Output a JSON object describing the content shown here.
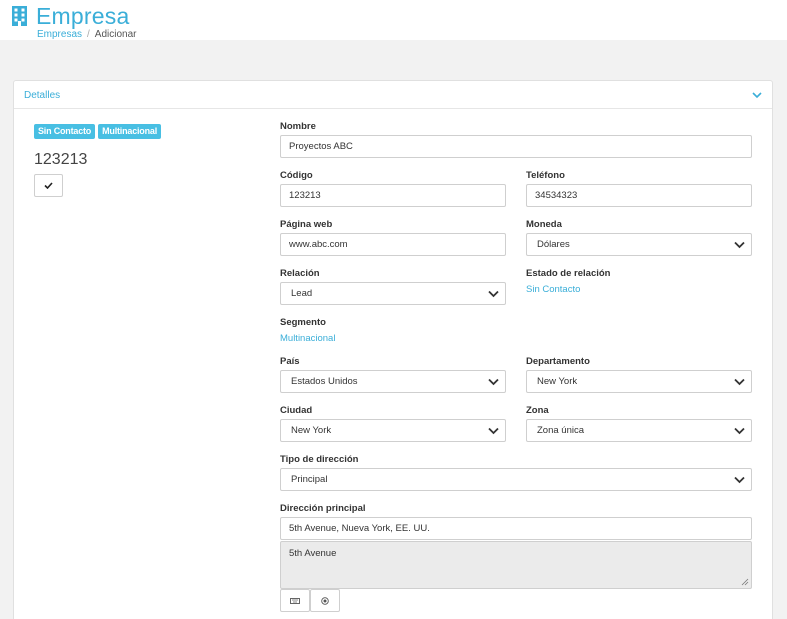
{
  "header": {
    "icon": "building-icon",
    "title": "Empresa",
    "breadcrumb": [
      "Empresas",
      "Adicionar"
    ],
    "accent_color": "#3aaed8"
  },
  "panel": {
    "title": "Detalles",
    "chevron_icon": "chevron-down-icon"
  },
  "summary": {
    "badges": [
      "Sin Contacto",
      "Multinacional"
    ],
    "badge_color": "#48bfe3",
    "code": "123213",
    "check_icon": "check-icon"
  },
  "form": {
    "nombre": {
      "label": "Nombre",
      "value": "Proyectos ABC"
    },
    "codigo": {
      "label": "Código",
      "value": "123213"
    },
    "telefono": {
      "label": "Teléfono",
      "value": "34534323"
    },
    "pagina_web": {
      "label": "Página web",
      "value": "www.abc.com"
    },
    "moneda": {
      "label": "Moneda",
      "value": "Dólares"
    },
    "relacion": {
      "label": "Relación",
      "value": "Lead"
    },
    "estado_relacion": {
      "label": "Estado de relación",
      "value": "Sin Contacto"
    },
    "segmento": {
      "label": "Segmento",
      "value": "Multinacional"
    },
    "pais": {
      "label": "País",
      "value": "Estados Unidos"
    },
    "departamento": {
      "label": "Departamento",
      "value": "New York"
    },
    "ciudad": {
      "label": "Ciudad",
      "value": "New York"
    },
    "zona": {
      "label": "Zona",
      "value": "Zona única"
    },
    "tipo_direccion": {
      "label": "Tipo de dirección",
      "value": "Principal"
    },
    "direccion_principal": {
      "label": "Dirección principal",
      "value": "5th Avenue, Nueva York, EE. UU.",
      "detail": "5th Avenue"
    },
    "address_buttons": [
      "keyboard-icon",
      "target-icon"
    ]
  }
}
